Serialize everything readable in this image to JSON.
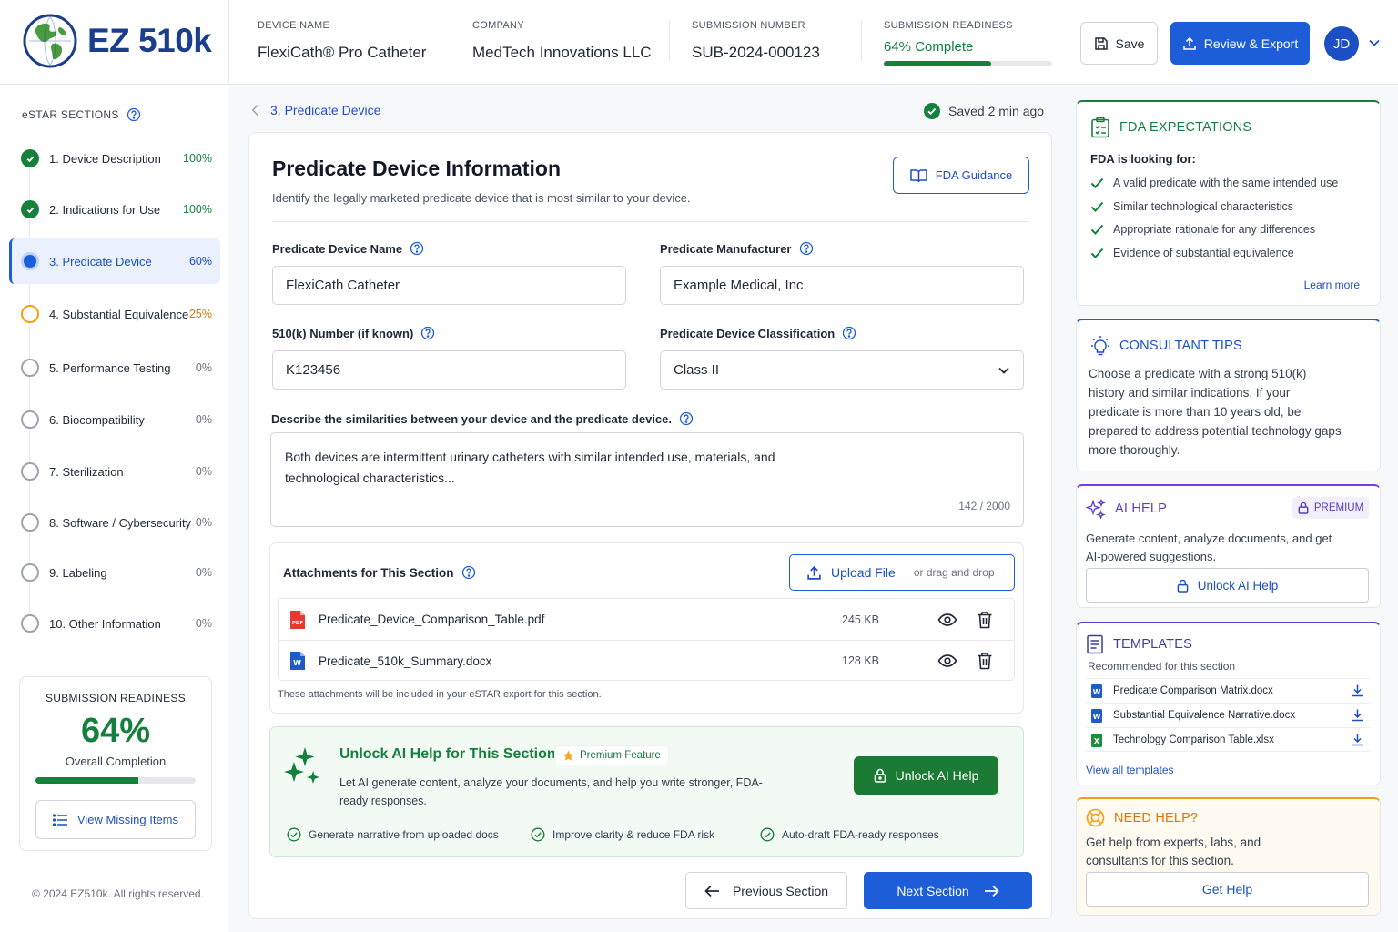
{
  "app": {
    "logo_text": "EZ 510k"
  },
  "header": {
    "device_label": "DEVICE NAME",
    "device_value": "FlexiCath® Pro Catheter",
    "company_label": "COMPANY",
    "company_value": "MedTech Innovations LLC",
    "submission_label": "SUBMISSION NUMBER",
    "submission_value": "SUB-2024-000123",
    "readiness_label": "SUBMISSION READINESS",
    "readiness_value": "64% Complete",
    "readiness_fraction": 0.64,
    "save_label": "Save",
    "export_label": "Review & Export",
    "avatar_initials": "JD"
  },
  "sidebar": {
    "title": "eSTAR SECTIONS",
    "items": [
      {
        "label": "1. Device Description",
        "pct": "100%"
      },
      {
        "label": "2. Indications for Use",
        "pct": "100%"
      },
      {
        "label": "3. Predicate Device",
        "pct": "60%"
      },
      {
        "label": "4. Substantial Equivalence",
        "pct": "25%"
      },
      {
        "label": "5. Performance Testing",
        "pct": "0%"
      },
      {
        "label": "6. Biocompatibility",
        "pct": "0%"
      },
      {
        "label": "7. Sterilization",
        "pct": "0%"
      },
      {
        "label": "8. Software / Cybersecurity",
        "pct": "0%"
      },
      {
        "label": "9. Labeling",
        "pct": "0%"
      },
      {
        "label": "10. Other Information",
        "pct": "0%"
      }
    ],
    "readiness": {
      "title": "SUBMISSION READINESS",
      "value": "64%",
      "fraction": 0.64,
      "subtitle": "Overall Completion",
      "button_label": "View Missing Items"
    },
    "copyright": "© 2024 EZ510k. All rights reserved."
  },
  "main": {
    "breadcrumb": "3. Predicate Device",
    "saved_status": "Saved 2 min ago",
    "title": "Predicate Device Information",
    "subtitle": "Identify the legally marketed predicate device that is most similar to your device.",
    "guidance_label": "FDA Guidance",
    "fields": {
      "predicate_name_label": "Predicate Device Name",
      "predicate_name_value": "FlexiCath Catheter",
      "manufacturer_label": "Predicate Manufacturer",
      "manufacturer_value": "Example Medical, Inc.",
      "k_number_label": "510(k) Number (if known)",
      "k_number_value": "K123456",
      "classification_label": "Predicate Device Classification",
      "classification_value": "Class II",
      "similarities_label": "Describe the similarities between your device and the predicate device.",
      "similarities_value": "Both devices are intermittent urinary catheters with similar intended use, materials, and technological characteristics...",
      "char_count": "142 / 2000"
    },
    "attachments": {
      "title": "Attachments for This Section",
      "upload_label": "Upload File",
      "upload_hint": "or drag and drop",
      "files": [
        {
          "name": "Predicate_Device_Comparison_Table.pdf",
          "size": "245 KB",
          "type_badge": "PDF"
        },
        {
          "name": "Predicate_510k_Summary.docx",
          "size": "128 KB",
          "type_badge": "W"
        }
      ],
      "note": "These attachments will be included in your eSTAR export for this section."
    },
    "ai_promo": {
      "title": "Unlock AI Help for This Section",
      "badge": "Premium Feature",
      "description": "Let AI generate content, analyze your documents, and help you write stronger, FDA-ready responses.",
      "button_label": "Unlock AI Help",
      "features": [
        "Generate narrative from uploaded docs",
        "Improve clarity & reduce FDA risk",
        "Auto-draft FDA-ready responses"
      ]
    },
    "prev_label": "Previous Section",
    "next_label": "Next Section"
  },
  "right": {
    "fda": {
      "title": "FDA EXPECTATIONS",
      "question": "FDA is looking for:",
      "items": [
        "A valid predicate with the same intended use",
        "Similar technological characteristics",
        "Appropriate rationale for any differences",
        "Evidence of substantial equivalence"
      ],
      "learn_more": "Learn more"
    },
    "tips": {
      "title": "CONSULTANT TIPS",
      "body": "Choose a predicate with a strong 510(k) history and similar indications. If your predicate is more than 10 years old, be prepared to address potential technology gaps more thoroughly."
    },
    "ai": {
      "title": "AI HELP",
      "badge": "PREMIUM",
      "body": "Generate content, analyze documents, and get AI-powered suggestions.",
      "button_label": "Unlock AI Help"
    },
    "templates": {
      "title": "TEMPLATES",
      "subtitle": "Recommended for this section",
      "items": [
        {
          "name": "Predicate Comparison Matrix.docx",
          "badge": "W"
        },
        {
          "name": "Substantial Equivalence Narrative.docx",
          "badge": "W"
        },
        {
          "name": "Technology Comparison Table.xlsx",
          "badge": "X"
        }
      ],
      "view_all": "View all templates"
    },
    "help": {
      "title": "NEED HELP?",
      "body": "Get help from experts, labs, and consultants for this section.",
      "button_label": "Get Help"
    }
  },
  "colors": {
    "primary_blue": "#1d5ed8",
    "success_green": "#16803d",
    "warning_amber": "#f59e0b",
    "premium_purple": "#5b3fc4"
  }
}
